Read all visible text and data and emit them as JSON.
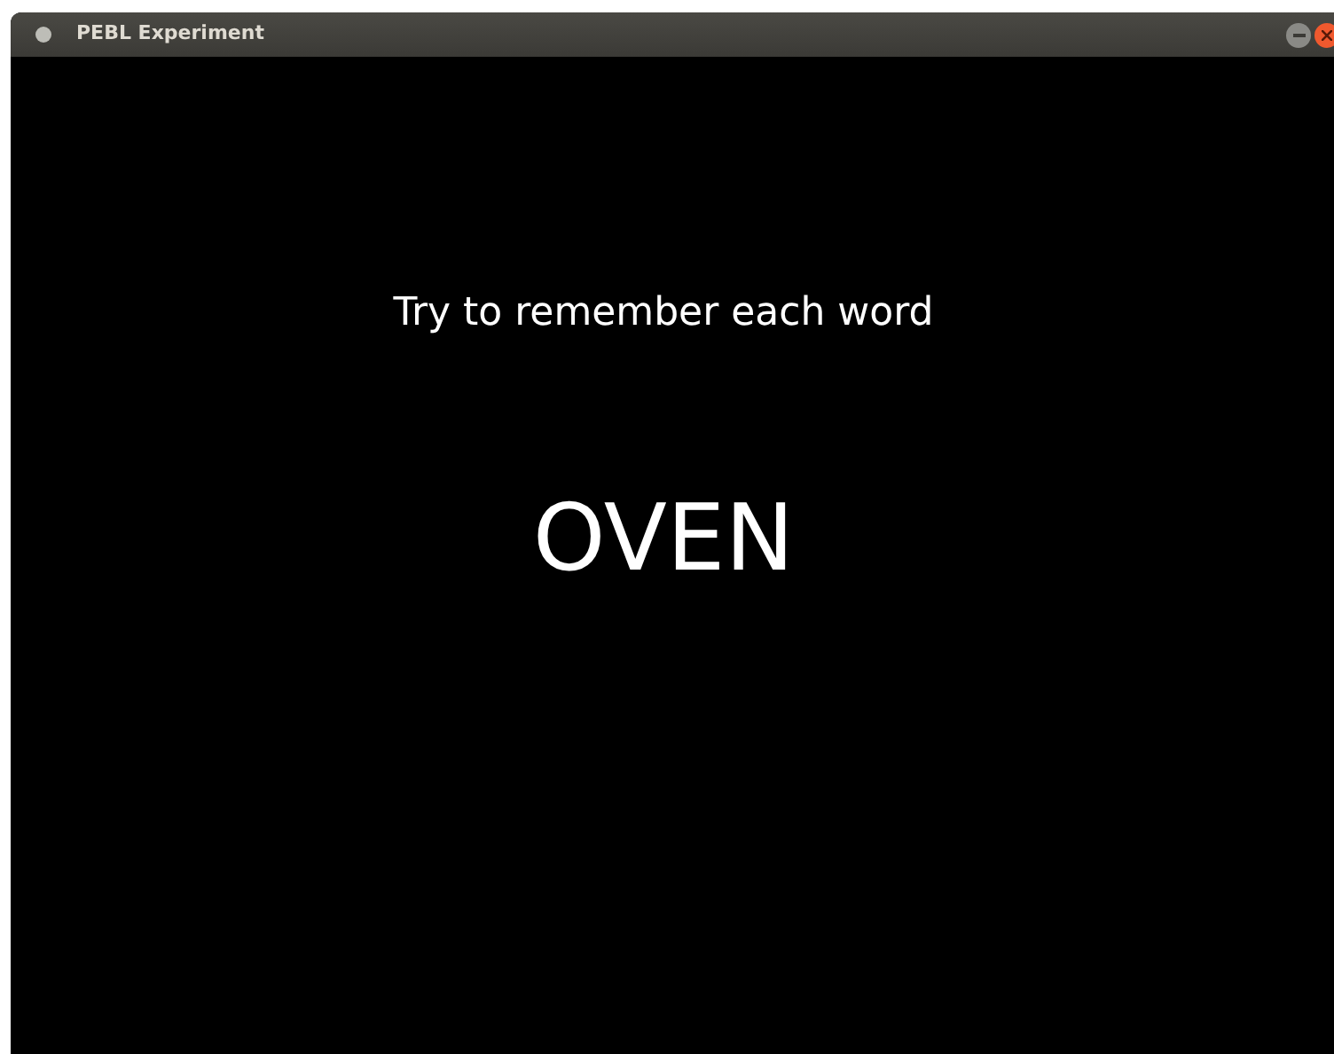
{
  "window": {
    "title": "PEBL Experiment"
  },
  "instruction": "Try to remember each word",
  "word": "OVEN"
}
